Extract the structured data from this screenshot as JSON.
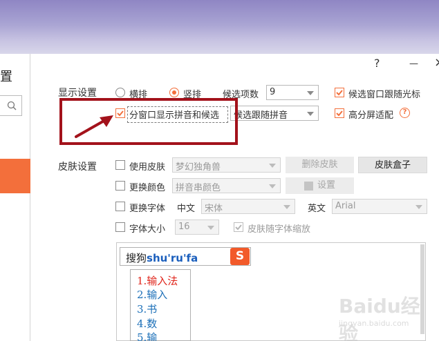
{
  "left_panel": {
    "title": "置"
  },
  "window_buttons": {
    "help": "?",
    "minimize": "—",
    "close": "×"
  },
  "display": {
    "section_label": "显示设置",
    "radio_horizontal": "横排",
    "radio_vertical": "竖排",
    "candidate_count_label": "候选项数",
    "candidate_count_value": "9",
    "follow_cursor_label": "候选窗口跟随光标",
    "split_window_label": "分窗口显示拼音和候选",
    "split_mode_value": "候选跟随拼音",
    "hidpi_label": "高分屏适配",
    "hidpi_help": "?"
  },
  "skin": {
    "section_label": "皮肤设置",
    "use_skin_label": "使用皮肤",
    "skin_value": "梦幻独角兽",
    "delete_skin": "删除皮肤",
    "skin_box": "皮肤盒子",
    "change_color_label": "更换颜色",
    "color_value": "拼音串颜色",
    "set_button": "设置",
    "change_font_label": "更换字体",
    "chinese_label": "中文",
    "chinese_font": "宋体",
    "english_label": "英文",
    "english_font": "Arial",
    "font_size_label": "字体大小",
    "font_size_value": "16",
    "scale_with_font_label": "皮肤随字体缩放"
  },
  "preview": {
    "prefix": "搜狗",
    "pinyin": "shu'ru'fa",
    "logo": "S",
    "candidates": [
      "1.输入法",
      "2.输入",
      "3.书",
      "4.数",
      "5.输"
    ]
  },
  "watermark": {
    "title": "Baidu经验",
    "url": "jingyan.baidu.com"
  },
  "colors": {
    "accent": "#f36f3b",
    "highlight": "#a3121b",
    "pinyin": "#1b5fbd",
    "candidate": "#1b6fb8",
    "first_candidate": "#e0261c"
  }
}
